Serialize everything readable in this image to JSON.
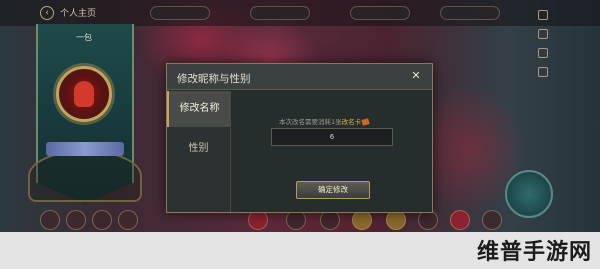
{
  "background": {
    "top_bar": {
      "label": "个人主页",
      "right_text": ""
    },
    "banner": {
      "player_name": "一包",
      "badge_text": ""
    }
  },
  "dialog": {
    "title": "修改昵称与性别",
    "close_icon": "close-icon",
    "tabs": [
      {
        "label": "修改名称",
        "active": true
      },
      {
        "label": "性别",
        "active": false
      }
    ],
    "notice_prefix": "本次改名需要消耗1张",
    "notice_item": "改名卡",
    "name_input_value": "6",
    "confirm_label": "确定修改"
  },
  "watermark": "维普手游网",
  "colors": {
    "dialog_bg": "#262d2d",
    "accent_gold": "#c9a35a",
    "notice_item": "#d6b24a"
  }
}
